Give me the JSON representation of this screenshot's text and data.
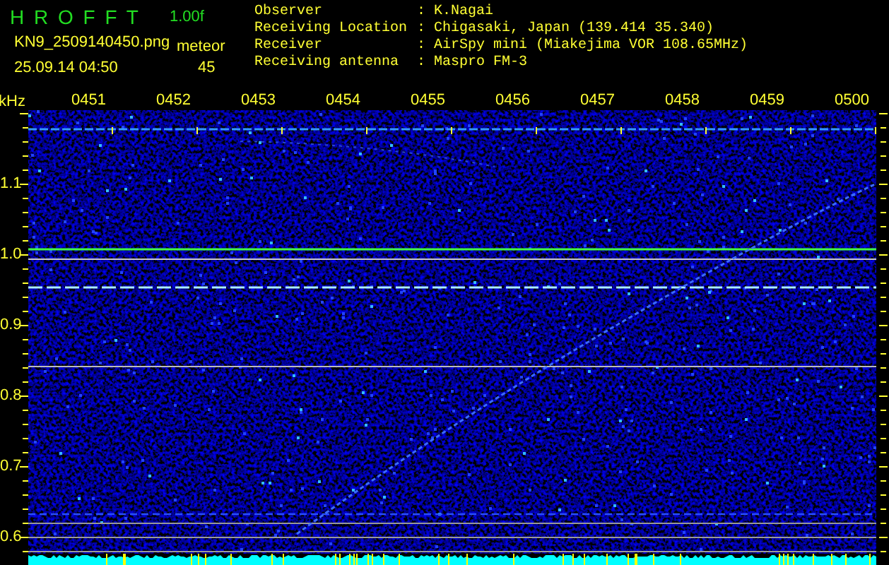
{
  "header": {
    "title": "H R O F F T",
    "version": "1.00f",
    "filename": "KN9_2509140450.png",
    "datetime": "25.09.14 04:50",
    "meteor_label": "meteor",
    "meteor_count": "45"
  },
  "info": [
    {
      "label": "Observer",
      "separator": ":",
      "value": "K.Nagai"
    },
    {
      "label": "Receiving Location",
      "separator": ":",
      "value": "Chigasaki, Japan (139.414 35.340)"
    },
    {
      "label": "Receiver",
      "separator": ":",
      "value": "AirSpy mini (Miakejima VOR 108.65MHz)"
    },
    {
      "label": "Receiving antenna",
      "separator": ":",
      "value": "Maspro FM-3"
    }
  ],
  "plot": {
    "unit": "kHz",
    "frequency_labels": [
      "1.1",
      "1.0",
      "0.9",
      "0.8",
      "0.7",
      "0.6"
    ],
    "time_labels": [
      "0451",
      "0452",
      "0453",
      "0454",
      "0455",
      "0456",
      "0457",
      "0458",
      "0459",
      "0500"
    ]
  }
}
